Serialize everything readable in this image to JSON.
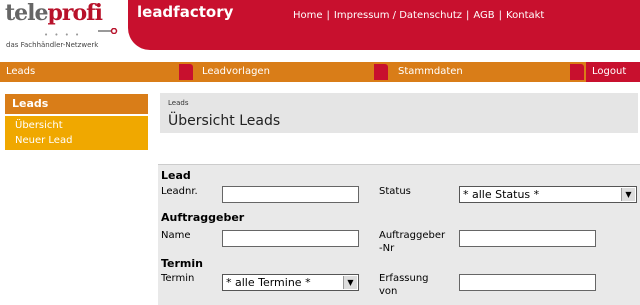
{
  "header": {
    "logo_tele": "tele",
    "logo_profi": "profi",
    "logo_tagline": "das Fachhändler-Netzwerk",
    "app_title": "leadfactory",
    "top_links": [
      "Home",
      "Impressum / Datenschutz",
      "AGB",
      "Kontakt"
    ]
  },
  "nav": {
    "items": [
      "Leads",
      "Leadvorlagen",
      "Stammdaten"
    ],
    "logout": "Logout"
  },
  "sidebar": {
    "heading": "Leads",
    "items": [
      "Übersicht",
      "Neuer Lead"
    ]
  },
  "breadcrumb": {
    "small": "Leads",
    "title": "Übersicht Leads"
  },
  "form": {
    "section_lead": "Lead",
    "leadnr_label": "Leadnr.",
    "leadnr_value": "",
    "status_label": "Status",
    "status_value": "* alle Status *",
    "section_auftraggeber": "Auftraggeber",
    "name_label": "Name",
    "name_value": "",
    "auftraggeber_nr_label_1": "Auftraggeber",
    "auftraggeber_nr_label_2": "-Nr",
    "auftraggeber_nr_value": "",
    "section_termin": "Termin",
    "termin_label": "Termin",
    "termin_value": "* alle Termine *",
    "erfassung_label_1": "Erfassung",
    "erfassung_label_2": "von",
    "erfassung_value": ""
  },
  "colors": {
    "brand_red": "#c8102e",
    "nav_orange": "#d97d18",
    "menu_yellow": "#f0a800"
  }
}
